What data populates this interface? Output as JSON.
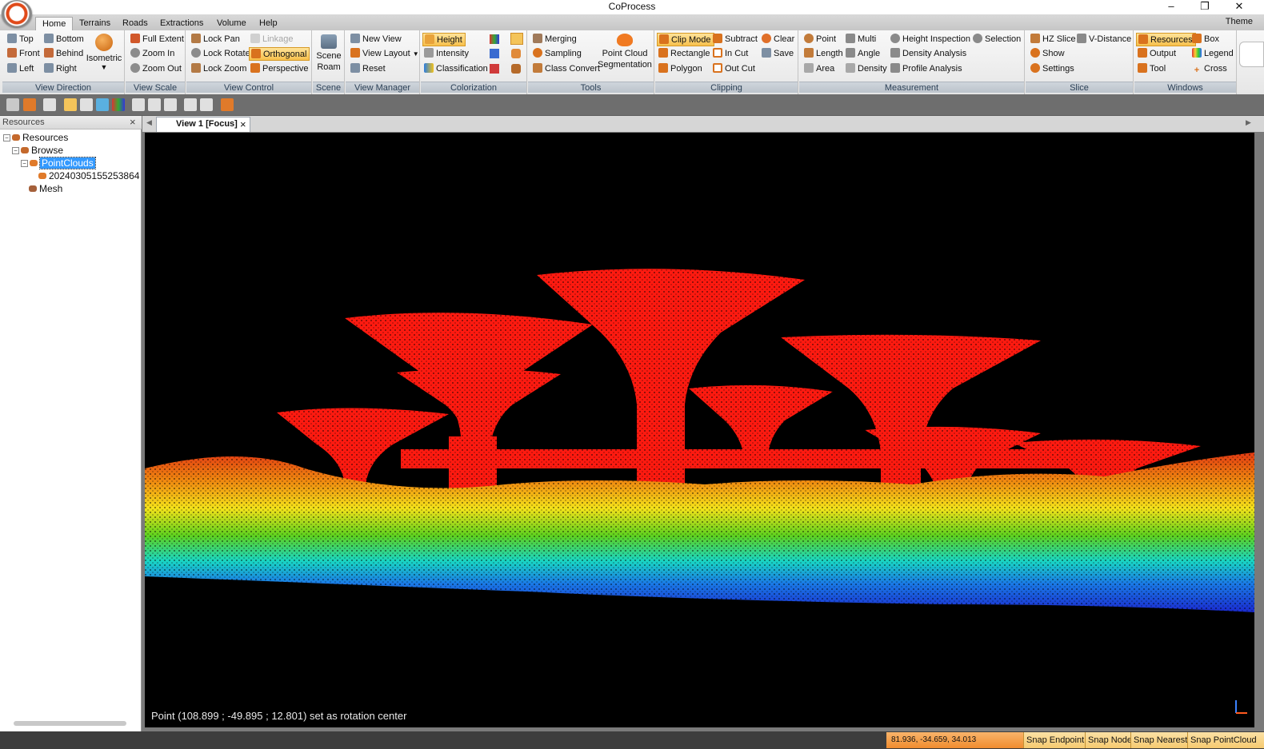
{
  "app": {
    "title": "CoProcess",
    "theme_label": "Theme"
  },
  "window_controls": {
    "minimize": "–",
    "restore": "❐",
    "close": "✕"
  },
  "menu": {
    "tabs": [
      "Home",
      "Terrains",
      "Roads",
      "Extractions",
      "Volume",
      "Help"
    ],
    "active": "Home"
  },
  "ribbon": {
    "view_direction": {
      "label": "View Direction",
      "buttons": [
        "Top",
        "Front",
        "Left",
        "Bottom",
        "Behind",
        "Right"
      ],
      "isometric": "Isometric"
    },
    "view_scale": {
      "label": "View Scale",
      "buttons": [
        "Full Extent",
        "Zoom In",
        "Zoom Out"
      ]
    },
    "view_control": {
      "label": "View Control",
      "buttons": [
        "Lock Pan",
        "Lock Rotate",
        "Lock Zoom",
        "Linkage",
        "Orthogonal",
        "Perspective"
      ]
    },
    "scene": {
      "label": "Scene",
      "roam_top": "Scene",
      "roam_bottom": "Roam"
    },
    "view_manager": {
      "label": "View Manager",
      "buttons": [
        "New View",
        "View Layout",
        "Reset"
      ]
    },
    "colorization": {
      "label": "Colorization",
      "buttons": [
        "Height",
        "Intensity",
        "Classification"
      ]
    },
    "tools": {
      "label": "Tools",
      "buttons": [
        "Merging",
        "Sampling",
        "Class Convert"
      ],
      "seg_top": "Point Cloud",
      "seg_bottom": "Segmentation"
    },
    "clipping": {
      "label": "Clipping",
      "buttons": [
        "Clip Mode",
        "Rectangle",
        "Polygon",
        "Subtract",
        "In Cut",
        "Out Cut",
        "Clear",
        "Save"
      ]
    },
    "measurement": {
      "label": "Measurement",
      "buttons": [
        "Point",
        "Length",
        "Area",
        "Multi",
        "Angle",
        "Density",
        "Height Inspection",
        "Density Analysis",
        "Profile Analysis",
        "Selection"
      ]
    },
    "slice": {
      "label": "Slice",
      "buttons": [
        "HZ Slice",
        "Show",
        "Settings",
        "V-Distance"
      ]
    },
    "windows": {
      "label": "Windows",
      "buttons": [
        "Resources",
        "Output",
        "Tool",
        "Box",
        "Legend",
        "Cross"
      ]
    }
  },
  "resources_panel": {
    "title": "Resources",
    "tree": {
      "root": "Resources",
      "browse": "Browse",
      "pointclouds": "PointClouds",
      "file": "20240305155253864",
      "mesh": "Mesh"
    }
  },
  "document": {
    "tab_label": "View 1 [Focus]"
  },
  "viewport": {
    "status_message": "Point (108.899 ; -49.895 ; 12.801) set as rotation center"
  },
  "statusbar": {
    "coordinates": "81.936, -34.659, 34.013",
    "snaps": [
      "Snap Endpoint",
      "Snap Node",
      "Snap Nearest",
      "Snap PointCloud"
    ]
  }
}
